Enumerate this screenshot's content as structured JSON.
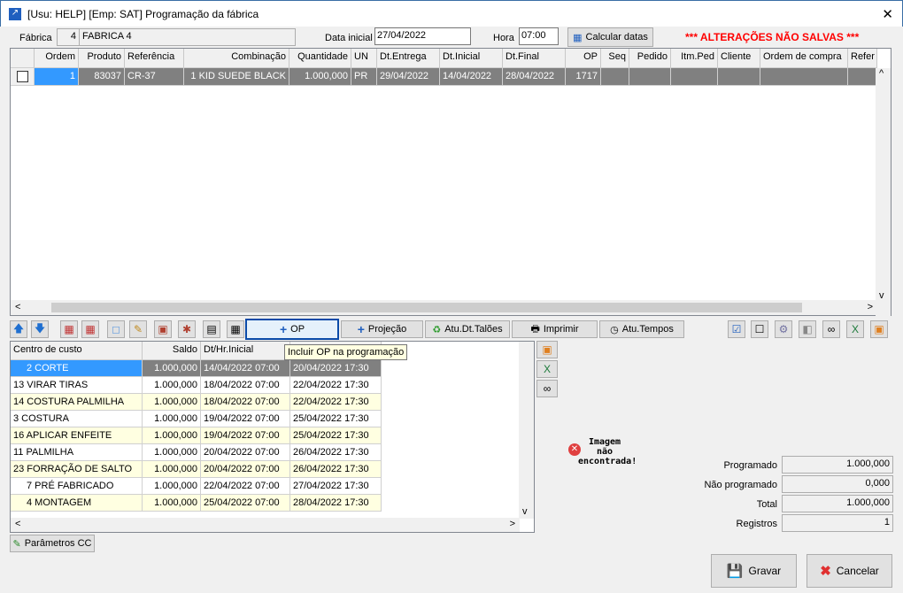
{
  "window": {
    "title": "[Usu: HELP] [Emp: SAT] Programação da fábrica",
    "close": "✕"
  },
  "form": {
    "fabrica_label": "Fábrica",
    "fabrica_code": "4",
    "fabrica_name": "FABRICA 4",
    "data_label": "Data inicial",
    "data_value": "27/04/2022",
    "hora_label": "Hora",
    "hora_value": "07:00",
    "calc_button": "Calcular datas",
    "warning": "*** ALTERAÇÕES NÃO SALVAS ***"
  },
  "upper_grid": {
    "columns": [
      "",
      "Ordem",
      "Produto",
      "Referência",
      "Combinação",
      "Quantidade",
      "UN",
      "Dt.Entrega",
      "Dt.Inicial",
      "Dt.Final",
      "OP",
      "Seq",
      "Pedido",
      "Itm.Ped",
      "Cliente",
      "Ordem de compra",
      "Refer"
    ],
    "rows": [
      [
        "",
        "1",
        "83037",
        "CR-37",
        "1 KID SUEDE BLACK",
        "1.000,000",
        "PR",
        "29/04/2022",
        "14/04/2022",
        "28/04/2022",
        "1717",
        "",
        "",
        "",
        "",
        "",
        ""
      ]
    ]
  },
  "toolbar": {
    "op": "OP",
    "projecao": "Projeção",
    "atu_taloes": "Atu.Dt.Talões",
    "imprimir": "Imprimir",
    "atu_tempos": "Atu.Tempos",
    "tooltip": "Incluir OP na programação"
  },
  "lower_grid": {
    "columns": [
      "Centro de custo",
      "Saldo",
      "Dt/Hr.Inicial",
      ""
    ],
    "rows": [
      [
        "2 CORTE",
        "1.000,000",
        "14/04/2022 07:00",
        "20/04/2022 17:30"
      ],
      [
        "13 VIRAR TIRAS",
        "1.000,000",
        "18/04/2022 07:00",
        "22/04/2022 17:30"
      ],
      [
        "14 COSTURA PALMILHA",
        "1.000,000",
        "18/04/2022 07:00",
        "22/04/2022 17:30"
      ],
      [
        "3 COSTURA",
        "1.000,000",
        "19/04/2022 07:00",
        "25/04/2022 17:30"
      ],
      [
        "16 APLICAR ENFEITE",
        "1.000,000",
        "19/04/2022 07:00",
        "25/04/2022 17:30"
      ],
      [
        "11 PALMILHA",
        "1.000,000",
        "20/04/2022 07:00",
        "26/04/2022 17:30"
      ],
      [
        "23 FORRAÇÃO DE SALTO",
        "1.000,000",
        "20/04/2022 07:00",
        "26/04/2022 17:30"
      ],
      [
        "7 PRÉ FABRICADO",
        "1.000,000",
        "22/04/2022 07:00",
        "27/04/2022 17:30"
      ],
      [
        "4 MONTAGEM",
        "1.000,000",
        "25/04/2022 07:00",
        "28/04/2022 17:30"
      ]
    ]
  },
  "image_missing": "Imagem não encontrada!",
  "totals": {
    "programado_label": "Programado",
    "programado": "1.000,000",
    "nao_label": "Não programado",
    "nao": "0,000",
    "total_label": "Total",
    "total": "1.000,000",
    "registros_label": "Registros",
    "registros": "1"
  },
  "buttons": {
    "parametros": "Parâmetros CC",
    "gravar": "Gravar",
    "cancelar": "Cancelar"
  },
  "colors": {
    "warning": "#ff0000",
    "selected": "#808080",
    "highlight": "#3399ff",
    "alt_row": "#ffffe1"
  }
}
